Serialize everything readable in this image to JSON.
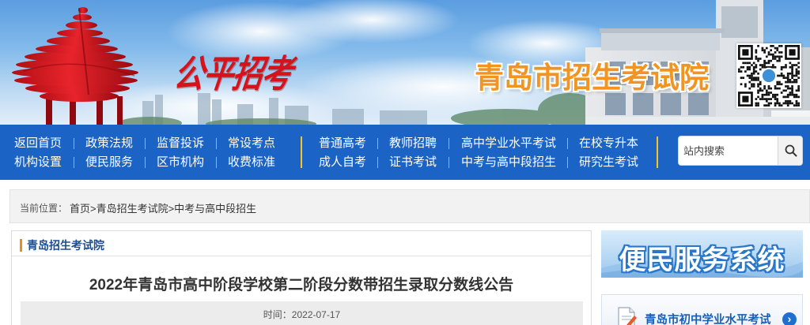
{
  "site": {
    "title": "青岛市招生考试院",
    "slogan": "公平招考"
  },
  "nav": {
    "left_row1": [
      "返回首页",
      "政策法规",
      "监督投诉",
      "常设考点"
    ],
    "left_row2": [
      "机构设置",
      "便民服务",
      "区市机构",
      "收费标准"
    ],
    "right_row1": [
      "普通高考",
      "教师招聘",
      "高中学业水平考试",
      "在校专升本"
    ],
    "right_row2": [
      "成人自考",
      "证书考试",
      "中考与高中段招生",
      "研究生考试"
    ]
  },
  "search": {
    "placeholder": "站内搜索",
    "icon": "search-icon"
  },
  "breadcrumb": {
    "label": "当前位置：",
    "path": "首页>青岛招生考试院>中考与高中段招生"
  },
  "panel": {
    "header": "青岛招生考试院"
  },
  "article": {
    "title": "2022年青岛市高中阶段学校第二阶段分数带招生录取分数线公告",
    "date": "时间：2022-07-17"
  },
  "sidebar": {
    "banner": "便民服务系统",
    "items": [
      {
        "label": "青岛市初中学业水平考试",
        "icon": "document-icon",
        "action_icon": "chevron-right-circle-icon"
      }
    ]
  },
  "colors": {
    "nav_bg": "#1b63c5",
    "title_accent": "#f29421",
    "header_bar": "#f08a1c",
    "link_blue": "#1a5fb4",
    "divider_yellow": "#f4c430"
  }
}
